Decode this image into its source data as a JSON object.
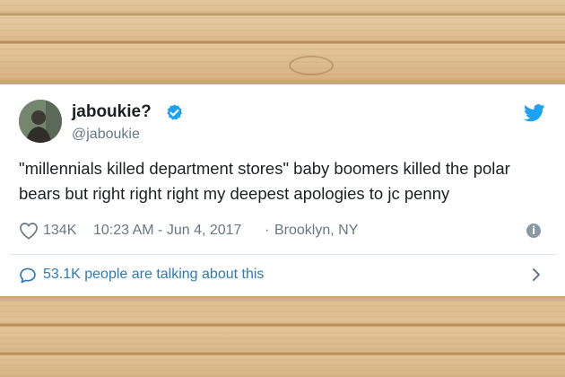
{
  "tweet": {
    "display_name": "jaboukie?",
    "handle": "@jaboukie",
    "text": "\"millennials killed department stores\" baby boomers killed the polar bears but right right right my deepest apologies to jc penny",
    "likes": "134K",
    "timestamp": "10:23 AM - Jun 4, 2017",
    "separator": "·",
    "location": "Brooklyn, NY",
    "conversation_text": "53.1K people are talking about this"
  },
  "icons": {
    "verified": "verified-badge-icon",
    "twitter_logo": "twitter-bird-icon",
    "like": "heart-icon",
    "info": "info-icon",
    "conversation": "chat-bubble-icon",
    "more": "chevron-right-icon"
  },
  "colors": {
    "twitter_blue": "#1da1f2",
    "link_blue": "#2b7bb9",
    "text_dark": "#1c2022",
    "text_gray": "#697882"
  }
}
